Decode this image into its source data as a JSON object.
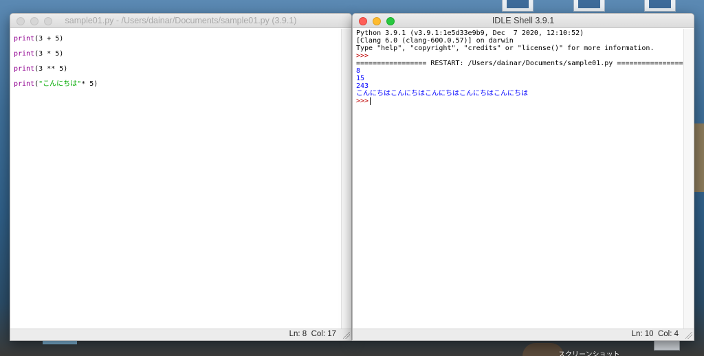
{
  "editor": {
    "title": "sample01.py - /Users/dainar/Documents/sample01.py (3.9.1)",
    "lines": [
      {
        "kw": "print",
        "pre": "(3 + 5)",
        "str": "",
        "post": ""
      },
      {
        "kw": "print",
        "pre": "(3 * 5)",
        "str": "",
        "post": ""
      },
      {
        "kw": "print",
        "pre": "(3 ** 5)",
        "str": "",
        "post": ""
      },
      {
        "kw": "print",
        "pre": "(",
        "str": "\"こんにちは\"",
        "post": "* 5)"
      }
    ],
    "status": {
      "ln": "Ln: 8",
      "col": "Col: 17"
    }
  },
  "shell": {
    "title": "IDLE Shell 3.9.1",
    "banner": [
      "Python 3.9.1 (v3.9.1:1e5d33e9b9, Dec  7 2020, 12:10:52)",
      "[Clang 6.0 (clang-600.0.57)] on darwin",
      "Type \"help\", \"copyright\", \"credits\" or \"license()\" for more information."
    ],
    "prompt": ">>>",
    "restart_line": "================= RESTART: /Users/dainar/Documents/sample01.py =================",
    "outputs": [
      "8",
      "15",
      "243",
      "こんにちはこんにちはこんにちはこんにちはこんにちは"
    ],
    "status": {
      "ln": "Ln: 10",
      "col": "Col: 4"
    }
  },
  "desktop": {
    "label": "スクリーンショット"
  },
  "colors": {
    "keyword": "#900090",
    "string": "#00aa00",
    "output": "#0000ff",
    "prompt": "#c00000"
  }
}
